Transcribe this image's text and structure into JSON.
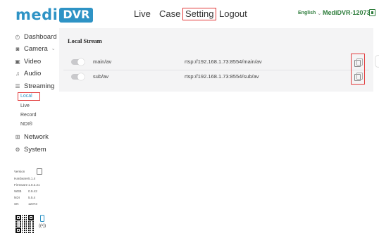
{
  "header": {
    "logo_left": "medi",
    "logo_box": "DVR",
    "nav": {
      "live": "Live",
      "case": "Case",
      "setting": "Setting",
      "logout": "Logout"
    },
    "language": "English",
    "device_name": "MediDVR-12073"
  },
  "sidebar": {
    "items": [
      {
        "label": "Dashboard",
        "icon": "dashboard-icon"
      },
      {
        "label": "Camera",
        "icon": "camera-icon"
      },
      {
        "label": "Video",
        "icon": "video-icon"
      },
      {
        "label": "Audio",
        "icon": "audio-icon"
      },
      {
        "label": "Streaming",
        "icon": "streaming-icon"
      }
    ],
    "streaming_sub": [
      "Local",
      "Live",
      "Record",
      "NDI®"
    ],
    "items_after": [
      {
        "label": "Network",
        "icon": "network-icon"
      },
      {
        "label": "System",
        "icon": "system-icon"
      }
    ],
    "info": [
      {
        "label": "Version",
        "value": ""
      },
      {
        "label": "Hardware",
        "value": "5.1.4"
      },
      {
        "label": "Firmware",
        "value": "1.0.2.21"
      },
      {
        "label": "WEB",
        "value": "0.9.42"
      },
      {
        "label": "NDI",
        "value": "5.5.4"
      },
      {
        "label": "SN",
        "value": "12073"
      }
    ]
  },
  "main": {
    "section_title": "Local Stream",
    "streams": [
      {
        "name": "main/av",
        "url": "rtsp://192.168.1.73:8554/main/av",
        "enabled": true
      },
      {
        "name": "sub/av",
        "url": "rtsp://192.168.1.73:8554/sub/av",
        "enabled": true
      }
    ]
  },
  "colors": {
    "brand": "#2e93c5",
    "device": "#2e7d3c",
    "highlight": "#e23a3a"
  }
}
